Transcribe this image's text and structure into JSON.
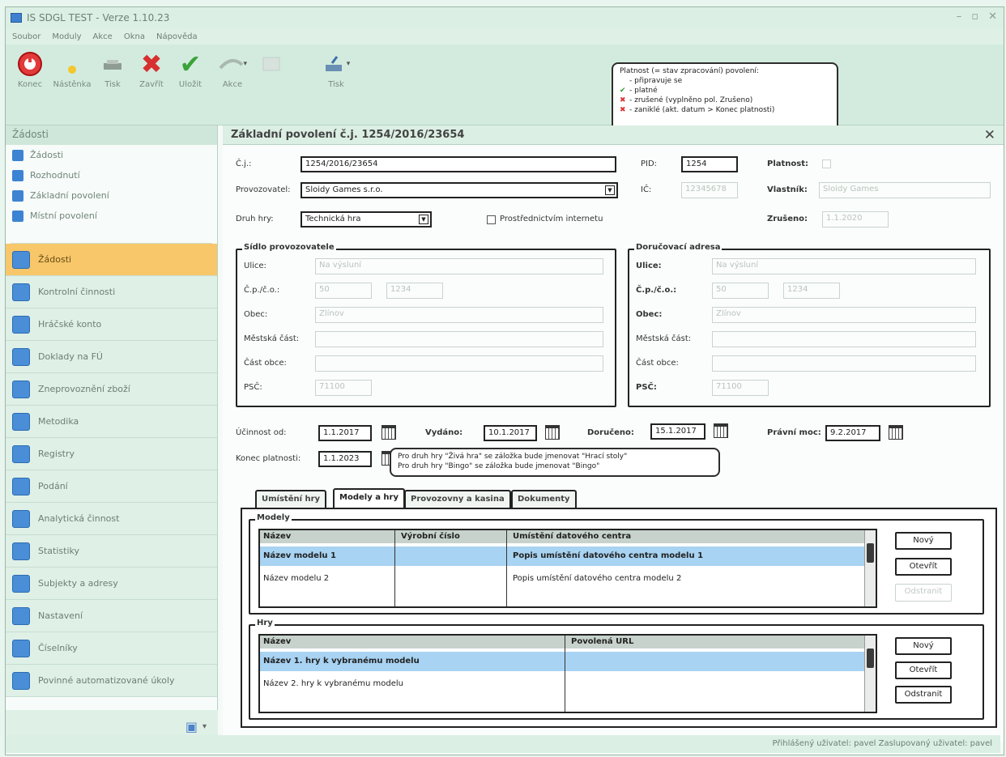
{
  "window": {
    "title": "IS SDGL TEST - Verze 1.10.23",
    "controls": [
      "–",
      "▫",
      "✕"
    ]
  },
  "menu": [
    "Soubor",
    "Moduly",
    "Akce",
    "Okna",
    "Nápověda"
  ],
  "toolbar": {
    "konec": "Konec",
    "nastenka": "Nástěnka",
    "tisk1": "Tisk",
    "zavrit": "Zavřít",
    "ulozit": "Uložit",
    "akce": "Akce",
    "tisk2": "Tisk"
  },
  "legend_callout": {
    "title": "Platnost (= stav zpracování) povolení:",
    "items": [
      "- připravuje se",
      "- platné",
      "- zrušené (vyplněno pol. Zrušeno)",
      "- zaniklé (akt. datum > Konec platnosti)"
    ]
  },
  "sidebar": {
    "header": "Žádosti",
    "small_items": [
      "Žádosti",
      "Rozhodnutí",
      "Základní povolení",
      "Místní povolení"
    ],
    "modules": [
      "Žádosti",
      "Kontrolní činnosti",
      "Hráčské konto",
      "Doklady na FÚ",
      "Zneprovoznění zboží",
      "Metodika",
      "Registry",
      "Podání",
      "Analytická činnost",
      "Statistiky",
      "Subjekty a adresy",
      "Nastavení",
      "Číselníky",
      "Povinné automatizované úkoly"
    ]
  },
  "form": {
    "header": "Základní povolení č.j. 1254/2016/23654",
    "cj_label": "Č.j.:",
    "cj_value": "1254/2016/23654",
    "pid_label": "PID:",
    "pid_value": "1254",
    "platnost_label": "Platnost:",
    "provozovatel_label": "Provozovatel:",
    "provozovatel_value": "Sloidy Games s.r.o.",
    "ic_label": "IČ:",
    "ic_value": "12345678",
    "vlastnik_label": "Vlastník:",
    "vlastnik_value": "Sloidy Games",
    "druh_label": "Druh hry:",
    "druh_value": "Technická hra",
    "prostrednictvim_label": "Prostřednictvím internetu",
    "zruseno_label": "Zrušeno:",
    "zruseno_value": "1.1.2020",
    "sidlo_title": "Sídlo provozovatele",
    "dorucovaci_title": "Doručovací adresa",
    "ulice_label": "Ulice:",
    "cp_label": "Č.p./č.o.:",
    "obec_label": "Obec:",
    "mestska_label": "Městská část:",
    "cast_label": "Část obce:",
    "psc_label": "PSČ:",
    "sidlo": {
      "ulice": "Na výsluní",
      "cp": "50",
      "co": "1234",
      "obec": "Zlínov",
      "psc": "71100"
    },
    "dorucovaci": {
      "ulice": "Na výsluní",
      "cp": "50",
      "co": "1234",
      "obec": "Zlínov",
      "psc": "71100"
    },
    "ucinnost_label": "Účinnost od:",
    "ucinnost_value": "1.1.2017",
    "vydano_label": "Vydáno:",
    "vydano_value": "10.1.2017",
    "doruceno_label": "Doručeno:",
    "doruceno_value": "15.1.2017",
    "pravni_label": "Právní moc:",
    "pravni_value": "9.2.2017",
    "konec_label": "Konec platnosti:",
    "konec_value": "1.1.2023",
    "tab_callout": [
      "Pro druh hry \"Živá hra\" se záložka bude jmenovat \"Hrací stoly\"",
      "Pro druh hry \"Bingo\" se záložka bude jmenovat \"Bingo\""
    ]
  },
  "tabs": [
    "Umístění hry",
    "Modely a hry",
    "Provozovny a kasina",
    "Dokumenty"
  ],
  "modely": {
    "title": "Modely",
    "columns": [
      "Název",
      "Výrobní číslo",
      "Umístění datového centra"
    ],
    "rows": [
      [
        "Název modelu 1",
        "",
        "Popis umístění datového centra modelu 1"
      ],
      [
        "Název modelu 2",
        "",
        "Popis umístění datového centra modelu 2"
      ]
    ],
    "buttons": [
      "Nový",
      "Otevřít",
      "Odstranit"
    ]
  },
  "hry": {
    "title": "Hry",
    "columns": [
      "Název",
      "Povolená URL"
    ],
    "rows": [
      [
        "Název 1. hry k vybranému modelu",
        ""
      ],
      [
        "Název 2. hry k vybranému modelu",
        ""
      ]
    ],
    "buttons": [
      "Nový",
      "Otevřít",
      "Odstranit"
    ]
  },
  "status": "Přihlášený uživatel: pavel  Zaslupovaný uživatel: pavel"
}
